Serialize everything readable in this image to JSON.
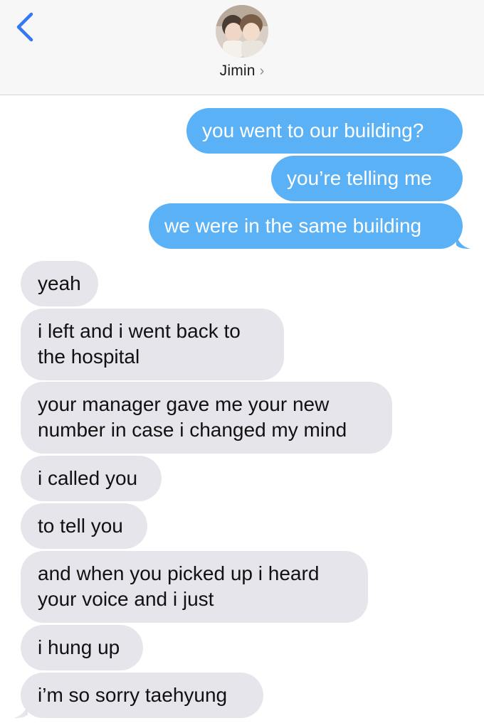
{
  "header": {
    "contact_name": "Jimin",
    "chevron": "›",
    "icons": [
      "back-chevron-icon",
      "contact-avatar"
    ]
  },
  "colors": {
    "sent_bubble": "#5ab1f6",
    "received_bubble": "#e6e5eb",
    "accent": "#3478f6"
  },
  "messages": [
    {
      "from": "me",
      "text": "you went to our building?"
    },
    {
      "from": "me",
      "text": "you’re telling me"
    },
    {
      "from": "me",
      "text": "we were in the same building"
    },
    {
      "from": "them",
      "text": "yeah"
    },
    {
      "from": "them",
      "text": "i left and i went back to\nthe hospital"
    },
    {
      "from": "them",
      "text": "your manager gave me your new\nnumber in case i changed my mind"
    },
    {
      "from": "them",
      "text": "i called you"
    },
    {
      "from": "them",
      "text": "to tell you"
    },
    {
      "from": "them",
      "text": "and when you picked up i heard\nyour voice and i just"
    },
    {
      "from": "them",
      "text": "i hung up"
    },
    {
      "from": "them",
      "text": "i’m so sorry taehyung"
    }
  ]
}
